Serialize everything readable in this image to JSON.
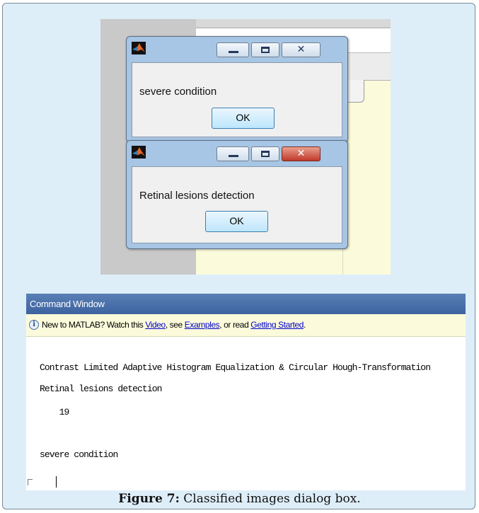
{
  "dialogs": [
    {
      "message": "severe condition",
      "ok_label": "OK",
      "icon": "matlab-icon",
      "active": false
    },
    {
      "message": "Retinal lesions detection",
      "ok_label": "OK",
      "icon": "matlab-icon",
      "active": true
    }
  ],
  "window_controls": {
    "minimize": "minimize-icon",
    "maximize": "maximize-icon",
    "close": "close-icon",
    "close_glyph": "✕"
  },
  "command_window": {
    "title": "Command Window",
    "info": {
      "icon": "info-icon",
      "icon_glyph": "i",
      "prefix": "New to MATLAB? Watch this ",
      "video_link": "Video",
      "sep1": ", see ",
      "examples_link": "Examples",
      "sep2": ", or read ",
      "getting_started_link": "Getting Started",
      "suffix": "."
    },
    "lines": [
      "Contrast Limited Adaptive Histogram Equalization & Circular Hough-Transformation",
      "Retinal lesions detection",
      "    19",
      "severe condition"
    ]
  },
  "caption": {
    "label": "Figure 7:",
    "text": " Classified images dialog box."
  },
  "colors": {
    "frame_background": "#deeef9",
    "dialog_frame": "#a7c5e4",
    "close_active": "#c0392b",
    "command_title_bar": "#4a6fa8",
    "info_bar": "#fbfbdc",
    "link": "#0000cc"
  }
}
